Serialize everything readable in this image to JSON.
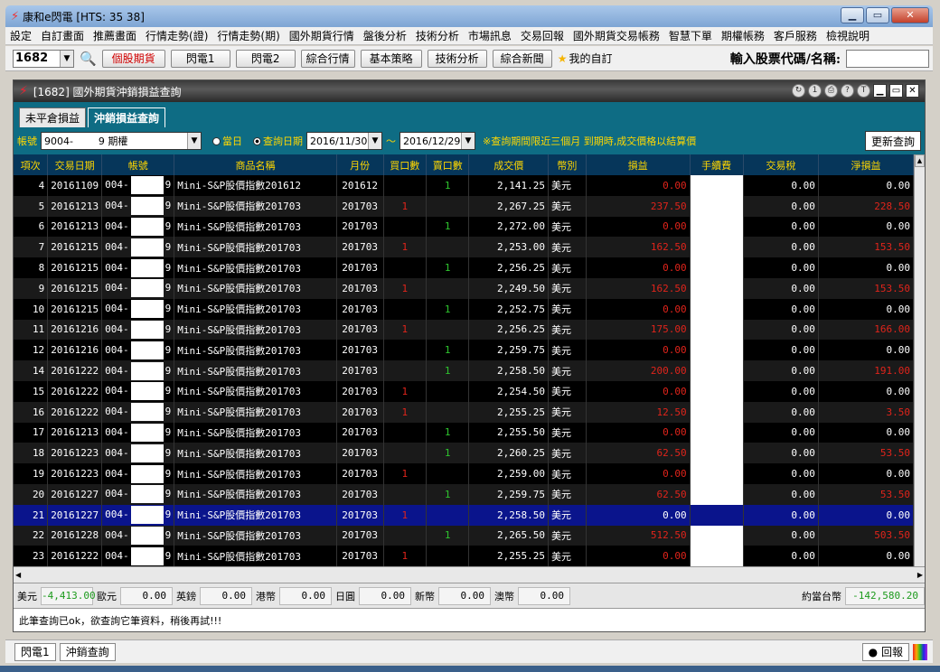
{
  "window": {
    "title": "康和e閃電 [HTS: 35 38]",
    "min": "▁",
    "max": "▭",
    "close": "✕"
  },
  "menu": [
    "設定",
    "自訂畫面",
    "推薦畫面",
    "行情走勢(證)",
    "行情走勢(期)",
    "國外期貨行情",
    "盤後分析",
    "技術分析",
    "市場訊息",
    "交易回報",
    "國外期貨交易帳務",
    "智慧下單",
    "期權帳務",
    "客戶服務",
    "檢視說明"
  ],
  "toolbar": {
    "stock_code": "1682",
    "buttons": [
      "個股期貨",
      "閃電1",
      "閃電2",
      "綜合行情",
      "基本策略",
      "技術分析",
      "綜合新聞"
    ],
    "fav": "我的自訂",
    "stock_label": "輸入股票代碼/名稱:",
    "stock_value": ""
  },
  "inner": {
    "title": "[1682] 國外期貨沖銷損益查詢",
    "tabs": [
      "未平倉損益",
      "沖銷損益查詢"
    ]
  },
  "filter": {
    "account_label": "帳號",
    "account": "9004-        9 期權",
    "radio_today": "當日",
    "radio_date": "查詢日期",
    "date_from": "2016/11/30",
    "tilde": "～",
    "date_to": "2016/12/29",
    "note": "※查詢期間限近三個月 到期時,成交價格以結算價",
    "refresh": "更新查詢"
  },
  "columns": [
    "項次",
    "交易日期",
    "帳號",
    "商品名稱",
    "月份",
    "買口數",
    "賣口數",
    "成交價",
    "幣別",
    "損益",
    "手續費",
    "交易稅",
    "淨損益"
  ],
  "rows": [
    {
      "no": "4",
      "date": "20161109",
      "acct": "004-",
      "acct2": "9",
      "product": "Mini-S&P股價指數201612",
      "month": "201612",
      "buy": "",
      "sell": "1",
      "price": "2,141.25",
      "cur": "美元",
      "pl": "0.00",
      "fee": "",
      "tax": "0.00",
      "net": "0.00"
    },
    {
      "no": "5",
      "date": "20161213",
      "acct": "004-",
      "acct2": "9",
      "product": "Mini-S&P股價指數201703",
      "month": "201703",
      "buy": "1",
      "sell": "",
      "price": "2,267.25",
      "cur": "美元",
      "pl": "237.50",
      "fee": "",
      "tax": "0.00",
      "net": "228.50"
    },
    {
      "no": "6",
      "date": "20161213",
      "acct": "004-",
      "acct2": "9",
      "product": "Mini-S&P股價指數201703",
      "month": "201703",
      "buy": "",
      "sell": "1",
      "price": "2,272.00",
      "cur": "美元",
      "pl": "0.00",
      "fee": "",
      "tax": "0.00",
      "net": "0.00"
    },
    {
      "no": "7",
      "date": "20161215",
      "acct": "004-",
      "acct2": "9",
      "product": "Mini-S&P股價指數201703",
      "month": "201703",
      "buy": "1",
      "sell": "",
      "price": "2,253.00",
      "cur": "美元",
      "pl": "162.50",
      "fee": "",
      "tax": "0.00",
      "net": "153.50"
    },
    {
      "no": "8",
      "date": "20161215",
      "acct": "004-",
      "acct2": "9",
      "product": "Mini-S&P股價指數201703",
      "month": "201703",
      "buy": "",
      "sell": "1",
      "price": "2,256.25",
      "cur": "美元",
      "pl": "0.00",
      "fee": "",
      "tax": "0.00",
      "net": "0.00"
    },
    {
      "no": "9",
      "date": "20161215",
      "acct": "004-",
      "acct2": "9",
      "product": "Mini-S&P股價指數201703",
      "month": "201703",
      "buy": "1",
      "sell": "",
      "price": "2,249.50",
      "cur": "美元",
      "pl": "162.50",
      "fee": "",
      "tax": "0.00",
      "net": "153.50"
    },
    {
      "no": "10",
      "date": "20161215",
      "acct": "004-",
      "acct2": "9",
      "product": "Mini-S&P股價指數201703",
      "month": "201703",
      "buy": "",
      "sell": "1",
      "price": "2,252.75",
      "cur": "美元",
      "pl": "0.00",
      "fee": "",
      "tax": "0.00",
      "net": "0.00"
    },
    {
      "no": "11",
      "date": "20161216",
      "acct": "004-",
      "acct2": "9",
      "product": "Mini-S&P股價指數201703",
      "month": "201703",
      "buy": "1",
      "sell": "",
      "price": "2,256.25",
      "cur": "美元",
      "pl": "175.00",
      "fee": "",
      "tax": "0.00",
      "net": "166.00"
    },
    {
      "no": "12",
      "date": "20161216",
      "acct": "004-",
      "acct2": "9",
      "product": "Mini-S&P股價指數201703",
      "month": "201703",
      "buy": "",
      "sell": "1",
      "price": "2,259.75",
      "cur": "美元",
      "pl": "0.00",
      "fee": "",
      "tax": "0.00",
      "net": "0.00"
    },
    {
      "no": "14",
      "date": "20161222",
      "acct": "004-",
      "acct2": "9",
      "product": "Mini-S&P股價指數201703",
      "month": "201703",
      "buy": "",
      "sell": "1",
      "price": "2,258.50",
      "cur": "美元",
      "pl": "200.00",
      "fee": "",
      "tax": "0.00",
      "net": "191.00"
    },
    {
      "no": "15",
      "date": "20161222",
      "acct": "004-",
      "acct2": "9",
      "product": "Mini-S&P股價指數201703",
      "month": "201703",
      "buy": "1",
      "sell": "",
      "price": "2,254.50",
      "cur": "美元",
      "pl": "0.00",
      "fee": "",
      "tax": "0.00",
      "net": "0.00"
    },
    {
      "no": "16",
      "date": "20161222",
      "acct": "004-",
      "acct2": "9",
      "product": "Mini-S&P股價指數201703",
      "month": "201703",
      "buy": "1",
      "sell": "",
      "price": "2,255.25",
      "cur": "美元",
      "pl": "12.50",
      "fee": "",
      "tax": "0.00",
      "net": "3.50"
    },
    {
      "no": "17",
      "date": "20161213",
      "acct": "004-",
      "acct2": "9",
      "product": "Mini-S&P股價指數201703",
      "month": "201703",
      "buy": "",
      "sell": "1",
      "price": "2,255.50",
      "cur": "美元",
      "pl": "0.00",
      "fee": "",
      "tax": "0.00",
      "net": "0.00"
    },
    {
      "no": "18",
      "date": "20161223",
      "acct": "004-",
      "acct2": "9",
      "product": "Mini-S&P股價指數201703",
      "month": "201703",
      "buy": "",
      "sell": "1",
      "price": "2,260.25",
      "cur": "美元",
      "pl": "62.50",
      "fee": "",
      "tax": "0.00",
      "net": "53.50"
    },
    {
      "no": "19",
      "date": "20161223",
      "acct": "004-",
      "acct2": "9",
      "product": "Mini-S&P股價指數201703",
      "month": "201703",
      "buy": "1",
      "sell": "",
      "price": "2,259.00",
      "cur": "美元",
      "pl": "0.00",
      "fee": "",
      "tax": "0.00",
      "net": "0.00"
    },
    {
      "no": "20",
      "date": "20161227",
      "acct": "004-",
      "acct2": "9",
      "product": "Mini-S&P股價指數201703",
      "month": "201703",
      "buy": "",
      "sell": "1",
      "price": "2,259.75",
      "cur": "美元",
      "pl": "62.50",
      "fee": "",
      "tax": "0.00",
      "net": "53.50"
    },
    {
      "no": "21",
      "date": "20161227",
      "acct": "004-",
      "acct2": "9",
      "product": "Mini-S&P股價指數201703",
      "month": "201703",
      "buy": "1",
      "sell": "",
      "price": "2,258.50",
      "cur": "美元",
      "pl": "0.00",
      "fee": "",
      "tax": "0.00",
      "net": "0.00",
      "selected": true
    },
    {
      "no": "22",
      "date": "20161228",
      "acct": "004-",
      "acct2": "9",
      "product": "Mini-S&P股價指數201703",
      "month": "201703",
      "buy": "",
      "sell": "1",
      "price": "2,265.50",
      "cur": "美元",
      "pl": "512.50",
      "fee": "",
      "tax": "0.00",
      "net": "503.50"
    },
    {
      "no": "23",
      "date": "20161222",
      "acct": "004-",
      "acct2": "9",
      "product": "Mini-S&P股價指數201703",
      "month": "201703",
      "buy": "1",
      "sell": "",
      "price": "2,255.25",
      "cur": "美元",
      "pl": "0.00",
      "fee": "",
      "tax": "0.00",
      "net": "0.00"
    }
  ],
  "totals": [
    {
      "cur": "美元",
      "amt": "-4,413.00"
    },
    {
      "cur": "歐元",
      "amt": "0.00"
    },
    {
      "cur": "英鎊",
      "amt": "0.00"
    },
    {
      "cur": "港幣",
      "amt": "0.00"
    },
    {
      "cur": "日圓",
      "amt": "0.00"
    },
    {
      "cur": "新幣",
      "amt": "0.00"
    },
    {
      "cur": "澳幣",
      "amt": "0.00"
    },
    {
      "cur": "約當台幣",
      "amt": "-142,580.20"
    }
  ],
  "message": "此筆查詢已ok，欲查詢它筆資料，稍後再試!!!",
  "statusbar": {
    "items": [
      "閃電1",
      "沖銷查詢"
    ],
    "report": "回報"
  },
  "colors": {
    "header_bg": "#06365a",
    "header_text": "#ffd700",
    "buy": "#e0241b",
    "sell": "#2ec42e",
    "selected": "#0a148c",
    "teal": "#0e6c84"
  }
}
